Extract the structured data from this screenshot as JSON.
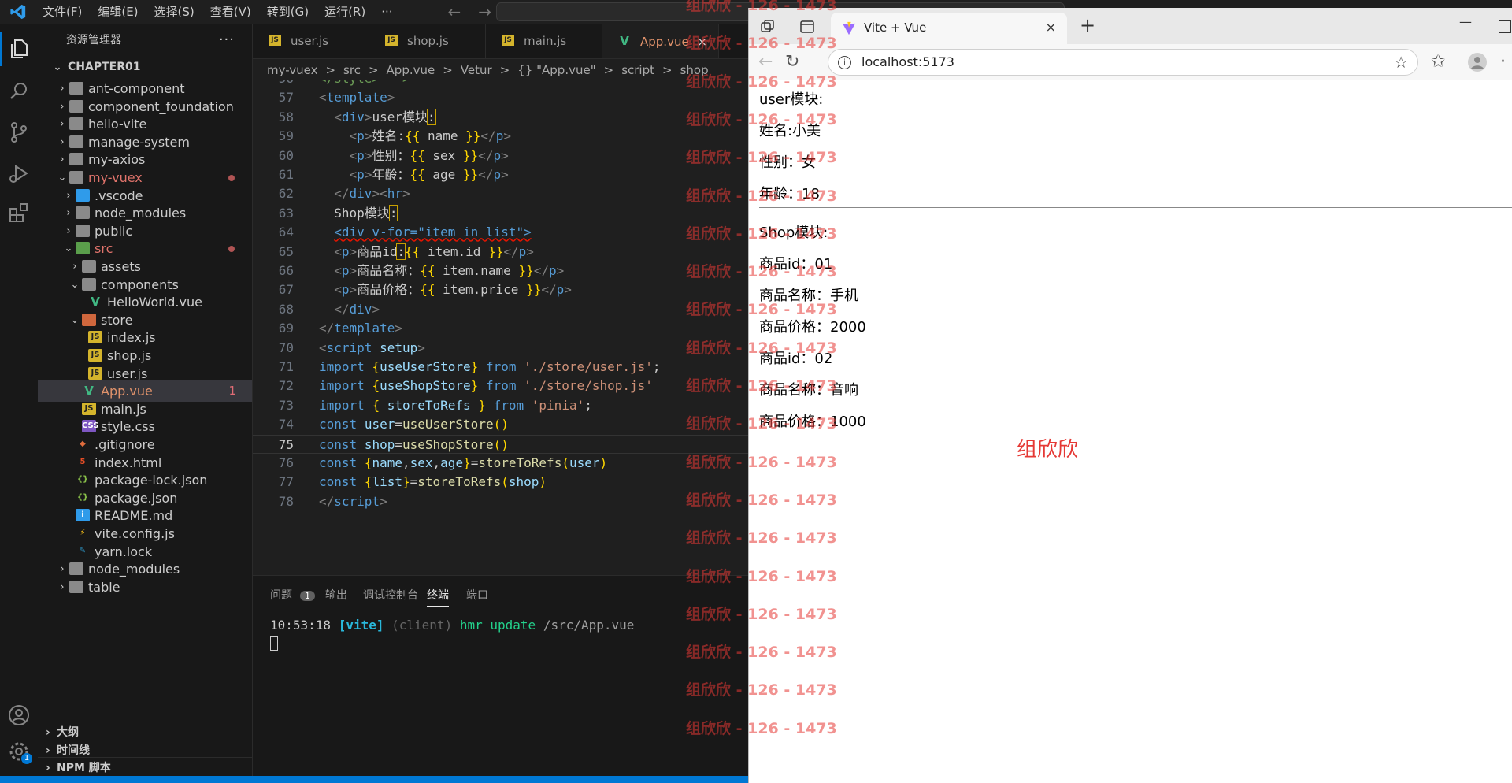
{
  "titlebar": {
    "menus": [
      "文件(F)",
      "编辑(E)",
      "选择(S)",
      "查看(V)",
      "转到(G)",
      "运行(R)",
      "···"
    ]
  },
  "sidebar": {
    "title": "资源管理器",
    "more": "···",
    "root": "CHAPTER01",
    "tree": [
      {
        "label": "ant-component",
        "depth": 0,
        "kind": "folder",
        "open": false
      },
      {
        "label": "component_foundation",
        "depth": 0,
        "kind": "folder",
        "open": false
      },
      {
        "label": "hello-vite",
        "depth": 0,
        "kind": "folder",
        "open": false
      },
      {
        "label": "manage-system",
        "depth": 0,
        "kind": "folder",
        "open": false
      },
      {
        "label": "my-axios",
        "depth": 0,
        "kind": "folder",
        "open": false
      },
      {
        "label": "my-vuex",
        "depth": 0,
        "kind": "folder",
        "open": true,
        "modified": true
      },
      {
        "label": ".vscode",
        "depth": 1,
        "kind": "folder",
        "open": false
      },
      {
        "label": "node_modules",
        "depth": 1,
        "kind": "folder",
        "open": false
      },
      {
        "label": "public",
        "depth": 1,
        "kind": "folder",
        "open": false
      },
      {
        "label": "src",
        "depth": 1,
        "kind": "folder",
        "open": true,
        "modified": true
      },
      {
        "label": "assets",
        "depth": 2,
        "kind": "folder",
        "open": false
      },
      {
        "label": "components",
        "depth": 2,
        "kind": "folder",
        "open": true
      },
      {
        "label": "HelloWorld.vue",
        "depth": 3,
        "kind": "vue"
      },
      {
        "label": "store",
        "depth": 2,
        "kind": "folder",
        "open": true
      },
      {
        "label": "index.js",
        "depth": 3,
        "kind": "js"
      },
      {
        "label": "shop.js",
        "depth": 3,
        "kind": "js"
      },
      {
        "label": "user.js",
        "depth": 3,
        "kind": "js"
      },
      {
        "label": "App.vue",
        "depth": 2,
        "kind": "vue",
        "active": true,
        "problems": "1"
      },
      {
        "label": "main.js",
        "depth": 2,
        "kind": "js"
      },
      {
        "label": "style.css",
        "depth": 2,
        "kind": "css"
      },
      {
        "label": ".gitignore",
        "depth": 1,
        "kind": "git"
      },
      {
        "label": "index.html",
        "depth": 1,
        "kind": "html"
      },
      {
        "label": "package-lock.json",
        "depth": 1,
        "kind": "json"
      },
      {
        "label": "package.json",
        "depth": 1,
        "kind": "json"
      },
      {
        "label": "README.md",
        "depth": 1,
        "kind": "info"
      },
      {
        "label": "vite.config.js",
        "depth": 1,
        "kind": "vite"
      },
      {
        "label": "yarn.lock",
        "depth": 1,
        "kind": "yarn"
      },
      {
        "label": "node_modules",
        "depth": 0,
        "kind": "folder",
        "open": false
      },
      {
        "label": "table",
        "depth": 0,
        "kind": "folder",
        "open": false
      }
    ],
    "sections": [
      "大纲",
      "时间线",
      "NPM 脚本"
    ]
  },
  "tabs": [
    {
      "label": "user.js",
      "kind": "js"
    },
    {
      "label": "shop.js",
      "kind": "js"
    },
    {
      "label": "main.js",
      "kind": "js"
    },
    {
      "label": "App.vue",
      "kind": "vue",
      "active": true,
      "close": "×"
    }
  ],
  "breadcrumb": [
    "my-vuex",
    ">",
    "src",
    ">",
    "App.vue",
    ">",
    "Vetur",
    ">",
    "{} \"App.vue\"",
    ">",
    "script",
    ">",
    "shop"
  ],
  "editor": {
    "current_line": "75",
    "lines": [
      {
        "n": "56",
        "segs": [
          [
            "cm",
            "</style> -->"
          ]
        ]
      },
      {
        "n": "57",
        "segs": [
          [
            "br",
            "<"
          ],
          [
            "tg",
            "template"
          ],
          [
            "br",
            ">"
          ]
        ]
      },
      {
        "n": "58",
        "segs": [
          [
            "",
            "  "
          ],
          [
            "br",
            "<"
          ],
          [
            "tg",
            "div"
          ],
          [
            "br",
            ">"
          ],
          [
            "",
            "user模块"
          ],
          [
            "hl",
            ":"
          ]
        ]
      },
      {
        "n": "59",
        "segs": [
          [
            "",
            "    "
          ],
          [
            "br",
            "<"
          ],
          [
            "tg",
            "p"
          ],
          [
            "br",
            ">"
          ],
          [
            "",
            "姓名:"
          ],
          [
            "yb",
            "{{"
          ],
          [
            "",
            " name "
          ],
          [
            "yb",
            "}}"
          ],
          [
            "br",
            "</"
          ],
          [
            "tg",
            "p"
          ],
          [
            "br",
            ">"
          ]
        ]
      },
      {
        "n": "60",
        "segs": [
          [
            "",
            "    "
          ],
          [
            "br",
            "<"
          ],
          [
            "tg",
            "p"
          ],
          [
            "br",
            ">"
          ],
          [
            "",
            "性别："
          ],
          [
            "yb",
            "{{"
          ],
          [
            "",
            " sex "
          ],
          [
            "yb",
            "}}"
          ],
          [
            "br",
            "</"
          ],
          [
            "tg",
            "p"
          ],
          [
            "br",
            ">"
          ]
        ]
      },
      {
        "n": "61",
        "segs": [
          [
            "",
            "    "
          ],
          [
            "br",
            "<"
          ],
          [
            "tg",
            "p"
          ],
          [
            "br",
            ">"
          ],
          [
            "",
            "年龄："
          ],
          [
            "yb",
            "{{"
          ],
          [
            "",
            " age "
          ],
          [
            "yb",
            "}}"
          ],
          [
            "br",
            "</"
          ],
          [
            "tg",
            "p"
          ],
          [
            "br",
            ">"
          ]
        ]
      },
      {
        "n": "62",
        "segs": [
          [
            "",
            "  "
          ],
          [
            "br",
            "</"
          ],
          [
            "tg",
            "div"
          ],
          [
            "br",
            "><"
          ],
          [
            "tg",
            "hr"
          ],
          [
            "br",
            ">"
          ]
        ]
      },
      {
        "n": "63",
        "segs": [
          [
            "",
            "  Shop模块"
          ],
          [
            "hl",
            ":"
          ]
        ]
      },
      {
        "n": "64",
        "segs": [
          [
            "",
            "  "
          ],
          [
            "sq",
            "<div v-for=\"item in list\">"
          ]
        ]
      },
      {
        "n": "65",
        "segs": [
          [
            "",
            "  "
          ],
          [
            "br",
            "<"
          ],
          [
            "tg",
            "p"
          ],
          [
            "br",
            ">"
          ],
          [
            "",
            "商品id"
          ],
          [
            "hl",
            ":"
          ],
          [
            "yb",
            "{{"
          ],
          [
            "",
            " item.id "
          ],
          [
            "yb",
            "}}"
          ],
          [
            "br",
            "</"
          ],
          [
            "tg",
            "p"
          ],
          [
            "br",
            ">"
          ]
        ]
      },
      {
        "n": "66",
        "segs": [
          [
            "",
            "  "
          ],
          [
            "br",
            "<"
          ],
          [
            "tg",
            "p"
          ],
          [
            "br",
            ">"
          ],
          [
            "",
            "商品名称："
          ],
          [
            "yb",
            "{{"
          ],
          [
            "",
            " item.name "
          ],
          [
            "yb",
            "}}"
          ],
          [
            "br",
            "</"
          ],
          [
            "tg",
            "p"
          ],
          [
            "br",
            ">"
          ]
        ]
      },
      {
        "n": "67",
        "segs": [
          [
            "",
            "  "
          ],
          [
            "br",
            "<"
          ],
          [
            "tg",
            "p"
          ],
          [
            "br",
            ">"
          ],
          [
            "",
            "商品价格："
          ],
          [
            "yb",
            "{{"
          ],
          [
            "",
            " item.price "
          ],
          [
            "yb",
            "}}"
          ],
          [
            "br",
            "</"
          ],
          [
            "tg",
            "p"
          ],
          [
            "br",
            ">"
          ]
        ]
      },
      {
        "n": "68",
        "segs": [
          [
            "",
            "  "
          ],
          [
            "br",
            "</"
          ],
          [
            "tg",
            "div"
          ],
          [
            "br",
            ">"
          ]
        ]
      },
      {
        "n": "69",
        "segs": [
          [
            "br",
            "</"
          ],
          [
            "tg",
            "template"
          ],
          [
            "br",
            ">"
          ]
        ]
      },
      {
        "n": "70",
        "segs": [
          [
            "br",
            "<"
          ],
          [
            "tg",
            "script"
          ],
          [
            "",
            " "
          ],
          [
            "at",
            "setup"
          ],
          [
            "br",
            ">"
          ]
        ]
      },
      {
        "n": "71",
        "segs": [
          [
            "kw",
            "import"
          ],
          [
            "",
            " "
          ],
          [
            "yb",
            "{"
          ],
          [
            "vr",
            "useUserStore"
          ],
          [
            "yb",
            "}"
          ],
          [
            "",
            " "
          ],
          [
            "kw",
            "from"
          ],
          [
            "",
            " "
          ],
          [
            "st",
            "'./store/user.js'"
          ],
          [
            "",
            ";"
          ]
        ]
      },
      {
        "n": "72",
        "segs": [
          [
            "kw",
            "import"
          ],
          [
            "",
            " "
          ],
          [
            "yb",
            "{"
          ],
          [
            "vr",
            "useShopStore"
          ],
          [
            "yb",
            "}"
          ],
          [
            "",
            " "
          ],
          [
            "kw",
            "from"
          ],
          [
            "",
            " "
          ],
          [
            "st",
            "'./store/shop.js'"
          ]
        ]
      },
      {
        "n": "73",
        "segs": [
          [
            "kw",
            "import"
          ],
          [
            "",
            " "
          ],
          [
            "yb",
            "{"
          ],
          [
            "",
            " "
          ],
          [
            "vr",
            "storeToRefs"
          ],
          [
            "",
            " "
          ],
          [
            "yb",
            "}"
          ],
          [
            "",
            " "
          ],
          [
            "kw",
            "from"
          ],
          [
            "",
            " "
          ],
          [
            "st",
            "'pinia'"
          ],
          [
            "",
            ";"
          ]
        ]
      },
      {
        "n": "74",
        "segs": [
          [
            "kw",
            "const"
          ],
          [
            "",
            " "
          ],
          [
            "vr",
            "user"
          ],
          [
            "",
            "="
          ],
          [
            "fn",
            "useUserStore"
          ],
          [
            "yb",
            "()"
          ]
        ]
      },
      {
        "n": "75",
        "segs": [
          [
            "kw",
            "const"
          ],
          [
            "",
            " "
          ],
          [
            "vr",
            "shop"
          ],
          [
            "",
            "="
          ],
          [
            "fn",
            "useShopStore"
          ],
          [
            "yb",
            "()"
          ]
        ]
      },
      {
        "n": "76",
        "segs": [
          [
            "kw",
            "const"
          ],
          [
            "",
            " "
          ],
          [
            "yb",
            "{"
          ],
          [
            "vr",
            "name"
          ],
          [
            "",
            ","
          ],
          [
            "vr",
            "sex"
          ],
          [
            "",
            ","
          ],
          [
            "vr",
            "age"
          ],
          [
            "yb",
            "}"
          ],
          [
            "",
            "="
          ],
          [
            "fn",
            "storeToRefs"
          ],
          [
            "yb",
            "("
          ],
          [
            "vr",
            "user"
          ],
          [
            "yb",
            ")"
          ]
        ]
      },
      {
        "n": "77",
        "segs": [
          [
            "kw",
            "const"
          ],
          [
            "",
            " "
          ],
          [
            "yb",
            "{"
          ],
          [
            "vr",
            "list"
          ],
          [
            "yb",
            "}"
          ],
          [
            "",
            "="
          ],
          [
            "fn",
            "storeToRefs"
          ],
          [
            "yb",
            "("
          ],
          [
            "vr",
            "shop"
          ],
          [
            "yb",
            ")"
          ]
        ]
      },
      {
        "n": "78",
        "segs": [
          [
            "br",
            "</"
          ],
          [
            "tg",
            "script"
          ],
          [
            "br",
            ">"
          ]
        ]
      }
    ]
  },
  "panel": {
    "tabs": [
      {
        "label": "问题",
        "badge": "1"
      },
      {
        "label": "输出"
      },
      {
        "label": "调试控制台"
      },
      {
        "label": "终端",
        "active": true
      },
      {
        "label": "端口"
      }
    ],
    "terminal": {
      "time": "10:53:18",
      "tag": "[vite]",
      "client": "(client)",
      "msg": "hmr update",
      "path": "/src/App.vue"
    }
  },
  "activity": {
    "account_badge": "1"
  },
  "browser": {
    "tab_title": "Vite + Vue",
    "tab_close": "×",
    "new_tab": "+",
    "minimize": "—",
    "url": "localhost:5173",
    "content": {
      "user_title": "user模块:",
      "name": "姓名:小美",
      "sex": "性别：女",
      "age": "年龄：18",
      "shop_title": "Shop模块:",
      "items": [
        {
          "id": "商品id：01",
          "name": "商品名称：手机",
          "price": "商品价格：2000"
        },
        {
          "id": "商品id：02",
          "name": "商品名称：音响",
          "price": "商品价格：1000"
        }
      ],
      "author": "组欣欣"
    }
  },
  "watermark": {
    "text": "组欣欣 - 126 - 1473",
    "count": 20
  },
  "colors": {
    "accent": "#0078d4",
    "watermark": "#e53935",
    "editor_bg": "#1f1f1f",
    "sidebar_bg": "#181818"
  }
}
